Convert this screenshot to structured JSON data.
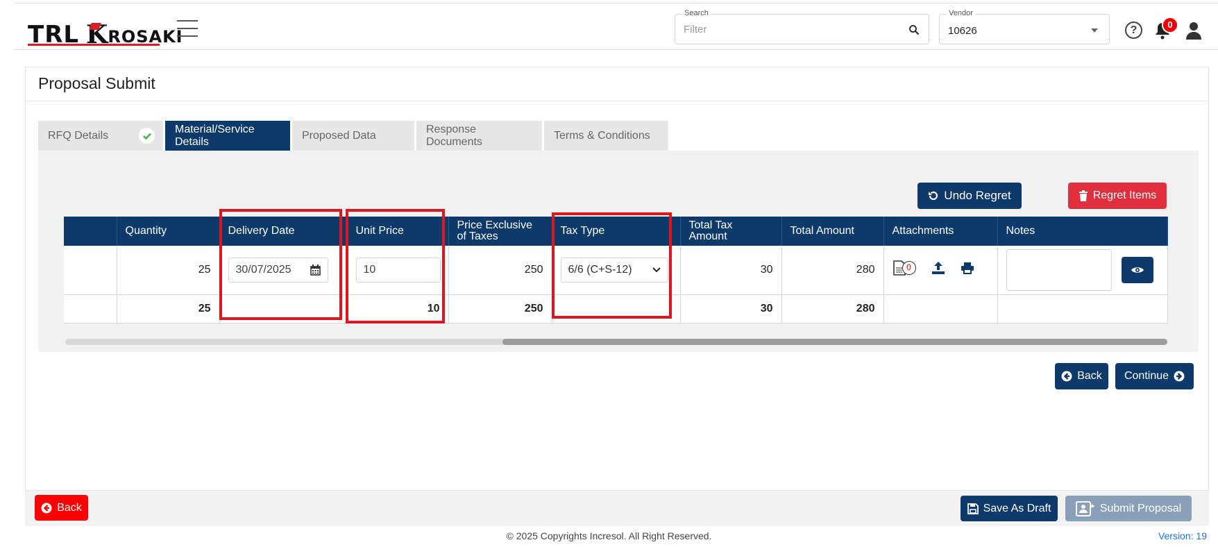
{
  "header": {
    "logo": {
      "part1": "TRL",
      "part2_initial": "K",
      "part2_rest": "ROSAKI"
    },
    "search": {
      "label": "Search",
      "placeholder": "Filter"
    },
    "vendor": {
      "label": "Vendor",
      "value": "10626"
    },
    "notifications_count": "0",
    "help_symbol": "?"
  },
  "page": {
    "title": "Proposal Submit",
    "tabs": [
      {
        "label": "RFQ Details",
        "completed": true
      },
      {
        "label": "Material/Service Details",
        "active": true
      },
      {
        "label": "Proposed Data"
      },
      {
        "label": "Response Documents"
      },
      {
        "label": "Terms & Conditions"
      }
    ],
    "actions": {
      "undo_regret": "Undo Regret",
      "regret_items": "Regret Items"
    },
    "table": {
      "columns": [
        "Quantity",
        "Delivery Date",
        "Unit Price",
        "Price Exclusive of Taxes",
        "Tax Type",
        "Total Tax Amount",
        "Total Amount",
        "Attachments",
        "Notes"
      ],
      "row": {
        "quantity": "25",
        "delivery_date": "30/07/2025",
        "unit_price": "10",
        "price_excl_taxes": "250",
        "tax_type": "6/6 (C+S-12)",
        "total_tax": "30",
        "total_amount": "280",
        "attachment_count": "0"
      },
      "totals": {
        "quantity": "25",
        "unit_price": "10",
        "price_excl_taxes": "250",
        "total_tax": "30",
        "total_amount": "280"
      }
    },
    "nav": {
      "back": "Back",
      "continue": "Continue"
    }
  },
  "footer": {
    "back": "Back",
    "save_draft": "Save As Draft",
    "submit": "Submit Proposal",
    "copyright": "© 2025 Copyrights Incresol. All Right Reserved.",
    "version": "Version: 19"
  },
  "colors": {
    "navy": "#0e3a6b",
    "red": "#e0303f",
    "highlight": "#e0161e",
    "success": "#4caf50"
  }
}
